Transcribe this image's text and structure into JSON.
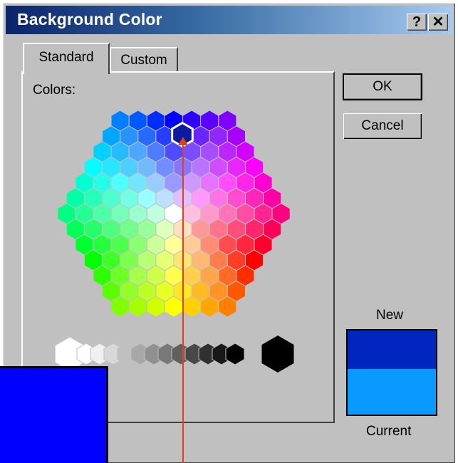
{
  "window": {
    "title": "Background Color"
  },
  "titlebar_buttons": {
    "help": "?",
    "close": "✕"
  },
  "tabs": [
    {
      "label": "Standard",
      "active": true
    },
    {
      "label": "Custom",
      "active": false
    }
  ],
  "colors_label": "Colors:",
  "buttons": {
    "ok": "OK",
    "cancel": "Cancel"
  },
  "preview": {
    "new_label": "New",
    "current_label": "Current",
    "new_color": "#0026c0",
    "current_color": "#0a9aff"
  },
  "selected_color": "#0b1a9e",
  "overlay_square_color": "#0000ff",
  "pointer_color": "#e0431a"
}
